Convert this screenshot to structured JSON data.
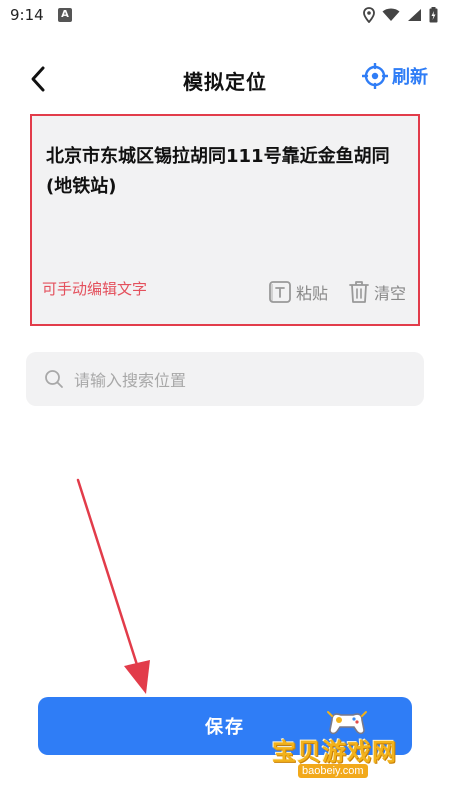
{
  "status_bar": {
    "time": "9:14",
    "app_badge": "A",
    "icons": [
      "location-icon",
      "wifi-icon",
      "signal-icon",
      "battery-icon"
    ]
  },
  "header": {
    "title": "模拟定位",
    "back_icon": "chevron-left-icon",
    "refresh_label": "刷新",
    "refresh_icon": "crosshair-icon"
  },
  "address_card": {
    "address": "北京市东城区锡拉胡同111号靠近金鱼胡同(地铁站)",
    "edit_hint": "可手动编辑文字",
    "paste_label": "粘贴",
    "clear_label": "清空",
    "highlight_color": "#e23c4a"
  },
  "search": {
    "placeholder": "请输入搜索位置"
  },
  "save_label": "保存",
  "watermark": {
    "main": "宝贝游戏网",
    "url": "baobeiy.com"
  },
  "colors": {
    "accent": "#2f7df6",
    "hint": "#e4505c",
    "annotation": "#e23c4a"
  }
}
